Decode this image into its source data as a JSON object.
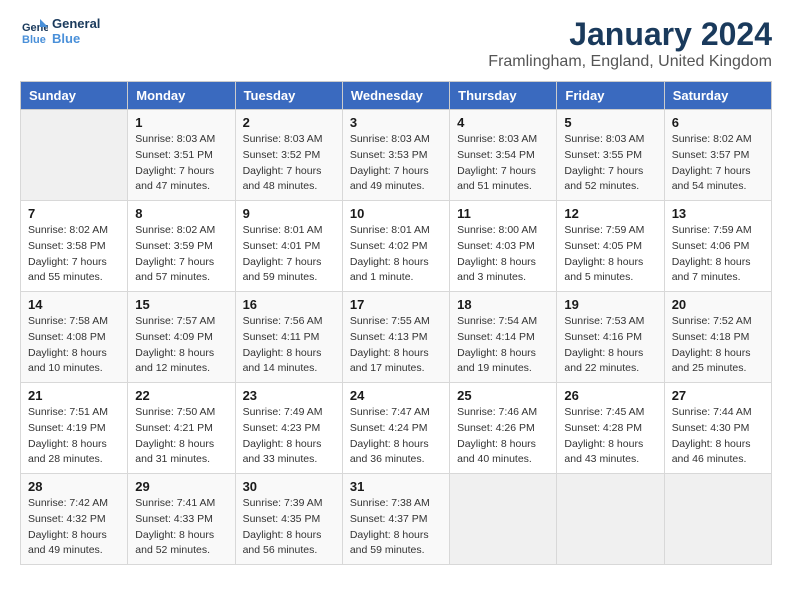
{
  "logo": {
    "line1": "General",
    "line2": "Blue"
  },
  "title": "January 2024",
  "location": "Framlingham, England, United Kingdom",
  "days_of_week": [
    "Sunday",
    "Monday",
    "Tuesday",
    "Wednesday",
    "Thursday",
    "Friday",
    "Saturday"
  ],
  "weeks": [
    [
      {
        "day": "",
        "info": ""
      },
      {
        "day": "1",
        "info": "Sunrise: 8:03 AM\nSunset: 3:51 PM\nDaylight: 7 hours\nand 47 minutes."
      },
      {
        "day": "2",
        "info": "Sunrise: 8:03 AM\nSunset: 3:52 PM\nDaylight: 7 hours\nand 48 minutes."
      },
      {
        "day": "3",
        "info": "Sunrise: 8:03 AM\nSunset: 3:53 PM\nDaylight: 7 hours\nand 49 minutes."
      },
      {
        "day": "4",
        "info": "Sunrise: 8:03 AM\nSunset: 3:54 PM\nDaylight: 7 hours\nand 51 minutes."
      },
      {
        "day": "5",
        "info": "Sunrise: 8:03 AM\nSunset: 3:55 PM\nDaylight: 7 hours\nand 52 minutes."
      },
      {
        "day": "6",
        "info": "Sunrise: 8:02 AM\nSunset: 3:57 PM\nDaylight: 7 hours\nand 54 minutes."
      }
    ],
    [
      {
        "day": "7",
        "info": "Sunrise: 8:02 AM\nSunset: 3:58 PM\nDaylight: 7 hours\nand 55 minutes."
      },
      {
        "day": "8",
        "info": "Sunrise: 8:02 AM\nSunset: 3:59 PM\nDaylight: 7 hours\nand 57 minutes."
      },
      {
        "day": "9",
        "info": "Sunrise: 8:01 AM\nSunset: 4:01 PM\nDaylight: 7 hours\nand 59 minutes."
      },
      {
        "day": "10",
        "info": "Sunrise: 8:01 AM\nSunset: 4:02 PM\nDaylight: 8 hours\nand 1 minute."
      },
      {
        "day": "11",
        "info": "Sunrise: 8:00 AM\nSunset: 4:03 PM\nDaylight: 8 hours\nand 3 minutes."
      },
      {
        "day": "12",
        "info": "Sunrise: 7:59 AM\nSunset: 4:05 PM\nDaylight: 8 hours\nand 5 minutes."
      },
      {
        "day": "13",
        "info": "Sunrise: 7:59 AM\nSunset: 4:06 PM\nDaylight: 8 hours\nand 7 minutes."
      }
    ],
    [
      {
        "day": "14",
        "info": "Sunrise: 7:58 AM\nSunset: 4:08 PM\nDaylight: 8 hours\nand 10 minutes."
      },
      {
        "day": "15",
        "info": "Sunrise: 7:57 AM\nSunset: 4:09 PM\nDaylight: 8 hours\nand 12 minutes."
      },
      {
        "day": "16",
        "info": "Sunrise: 7:56 AM\nSunset: 4:11 PM\nDaylight: 8 hours\nand 14 minutes."
      },
      {
        "day": "17",
        "info": "Sunrise: 7:55 AM\nSunset: 4:13 PM\nDaylight: 8 hours\nand 17 minutes."
      },
      {
        "day": "18",
        "info": "Sunrise: 7:54 AM\nSunset: 4:14 PM\nDaylight: 8 hours\nand 19 minutes."
      },
      {
        "day": "19",
        "info": "Sunrise: 7:53 AM\nSunset: 4:16 PM\nDaylight: 8 hours\nand 22 minutes."
      },
      {
        "day": "20",
        "info": "Sunrise: 7:52 AM\nSunset: 4:18 PM\nDaylight: 8 hours\nand 25 minutes."
      }
    ],
    [
      {
        "day": "21",
        "info": "Sunrise: 7:51 AM\nSunset: 4:19 PM\nDaylight: 8 hours\nand 28 minutes."
      },
      {
        "day": "22",
        "info": "Sunrise: 7:50 AM\nSunset: 4:21 PM\nDaylight: 8 hours\nand 31 minutes."
      },
      {
        "day": "23",
        "info": "Sunrise: 7:49 AM\nSunset: 4:23 PM\nDaylight: 8 hours\nand 33 minutes."
      },
      {
        "day": "24",
        "info": "Sunrise: 7:47 AM\nSunset: 4:24 PM\nDaylight: 8 hours\nand 36 minutes."
      },
      {
        "day": "25",
        "info": "Sunrise: 7:46 AM\nSunset: 4:26 PM\nDaylight: 8 hours\nand 40 minutes."
      },
      {
        "day": "26",
        "info": "Sunrise: 7:45 AM\nSunset: 4:28 PM\nDaylight: 8 hours\nand 43 minutes."
      },
      {
        "day": "27",
        "info": "Sunrise: 7:44 AM\nSunset: 4:30 PM\nDaylight: 8 hours\nand 46 minutes."
      }
    ],
    [
      {
        "day": "28",
        "info": "Sunrise: 7:42 AM\nSunset: 4:32 PM\nDaylight: 8 hours\nand 49 minutes."
      },
      {
        "day": "29",
        "info": "Sunrise: 7:41 AM\nSunset: 4:33 PM\nDaylight: 8 hours\nand 52 minutes."
      },
      {
        "day": "30",
        "info": "Sunrise: 7:39 AM\nSunset: 4:35 PM\nDaylight: 8 hours\nand 56 minutes."
      },
      {
        "day": "31",
        "info": "Sunrise: 7:38 AM\nSunset: 4:37 PM\nDaylight: 8 hours\nand 59 minutes."
      },
      {
        "day": "",
        "info": ""
      },
      {
        "day": "",
        "info": ""
      },
      {
        "day": "",
        "info": ""
      }
    ]
  ]
}
